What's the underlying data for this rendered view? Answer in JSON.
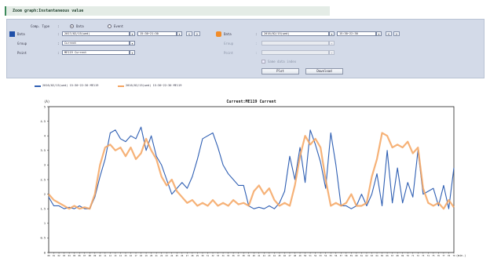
{
  "header": {
    "title": "Zoom graph:Instantaneous value"
  },
  "form": {
    "comp_type": {
      "label": "Comp. Type",
      "options": [
        {
          "label": "Data",
          "checked": true
        },
        {
          "label": "Event",
          "checked": false
        }
      ]
    },
    "left": {
      "date_label": "Data",
      "date_value": "2017/02/15(wed)",
      "time_value": "15:30~21:30",
      "group_label": "Group",
      "group_value": "Current",
      "point_label": "Point",
      "point_value": "ME119 Current",
      "swatch_color": "#1f4fa8"
    },
    "right": {
      "date_label": "Data",
      "date_value": "2016/02/15(wed)",
      "time_value": "15:30~22:30",
      "group_label": "Group",
      "group_value": "",
      "point_label": "Point",
      "point_value": "",
      "swatch_color": "#f28c28"
    },
    "checkbox_label": "Same data index",
    "buttons": {
      "plot": "Plot",
      "download": "Download"
    }
  },
  "legend": [
    {
      "label": "2016/02/15(wed) 15:30~22:30 ME119",
      "color": "#2f5fb3"
    },
    {
      "label": "2016/02/15(wed) 15:30~22:30 ME119",
      "color": "#f4a460"
    }
  ],
  "colors": {
    "blue": "#2f5fb3",
    "orange": "#f4a460",
    "plot_bg": "#ffffff"
  },
  "chart_data": {
    "type": "line",
    "title": "Current:ME119 Current",
    "ylabel": "(A)",
    "xlabel": "(min.)",
    "ylim": [
      0,
      5
    ],
    "yticks": [
      "5",
      "4.5",
      "4",
      "3.5",
      "3",
      "2.5",
      "2",
      "1.5",
      "1",
      "0.5",
      "0"
    ],
    "x": [
      "00",
      "01",
      "02",
      "03",
      "04",
      "05",
      "06",
      "07",
      "08",
      "09",
      "10",
      "11",
      "12",
      "13",
      "14",
      "15",
      "16",
      "17",
      "18",
      "19",
      "20",
      "21",
      "22",
      "23",
      "24",
      "25",
      "26",
      "27",
      "28",
      "29",
      "30",
      "31",
      "32",
      "33",
      "34",
      "35",
      "36",
      "37",
      "38",
      "39",
      "40",
      "41",
      "42",
      "43",
      "44",
      "45",
      "46",
      "47",
      "48",
      "49",
      "50",
      "51",
      "52",
      "53",
      "54",
      "55",
      "56",
      "57",
      "58",
      "59",
      "60",
      "61",
      "62",
      "63",
      "64",
      "65",
      "66",
      "67",
      "68",
      "69",
      "70",
      "71",
      "72",
      "73",
      "74",
      "75",
      "76",
      "77",
      "78",
      "79"
    ],
    "series": [
      {
        "color": "#2f5fb3",
        "values": [
          1.9,
          1.6,
          1.6,
          1.5,
          1.55,
          1.5,
          1.6,
          1.5,
          1.5,
          1.9,
          2.6,
          3.2,
          4.1,
          4.2,
          3.9,
          3.8,
          4.0,
          3.9,
          4.3,
          3.5,
          4.0,
          3.3,
          3.0,
          2.5,
          2.0,
          2.2,
          2.4,
          2.2,
          2.6,
          3.2,
          3.9,
          4.0,
          4.1,
          3.6,
          3.0,
          2.7,
          2.5,
          2.3,
          2.3,
          1.6,
          1.5,
          1.55,
          1.5,
          1.6,
          1.5,
          1.7,
          2.1,
          3.3,
          2.5,
          3.6,
          2.4,
          4.2,
          3.7,
          3.1,
          2.2,
          4.1,
          3.0,
          1.6,
          1.6,
          1.5,
          1.6,
          2.0,
          1.6,
          2.0,
          2.7,
          1.6,
          3.5,
          1.7,
          2.9,
          1.7,
          2.4,
          1.9,
          3.5,
          2.0,
          2.1,
          2.2,
          1.6,
          2.3,
          1.5,
          2.9
        ]
      },
      {
        "color": "#f4a460",
        "values": [
          2.0,
          1.8,
          1.7,
          1.6,
          1.5,
          1.6,
          1.5,
          1.55,
          1.5,
          2.0,
          3.0,
          3.6,
          3.7,
          3.5,
          3.6,
          3.3,
          3.6,
          3.2,
          3.4,
          3.9,
          3.5,
          3.2,
          2.6,
          2.3,
          2.5,
          2.1,
          1.9,
          1.7,
          1.8,
          1.6,
          1.7,
          1.6,
          1.8,
          1.6,
          1.7,
          1.6,
          1.8,
          1.65,
          1.7,
          1.6,
          2.1,
          2.3,
          2.0,
          2.2,
          1.8,
          1.6,
          1.7,
          1.6,
          2.3,
          3.3,
          4.0,
          3.7,
          3.9,
          3.6,
          2.5,
          1.6,
          1.7,
          1.6,
          1.7,
          2.0,
          1.6,
          1.6,
          1.7,
          2.6,
          3.2,
          4.1,
          4.0,
          3.6,
          3.7,
          3.6,
          3.8,
          3.4,
          3.6,
          2.2,
          1.7,
          1.6,
          1.7,
          1.5,
          1.8,
          1.55
        ]
      }
    ]
  }
}
